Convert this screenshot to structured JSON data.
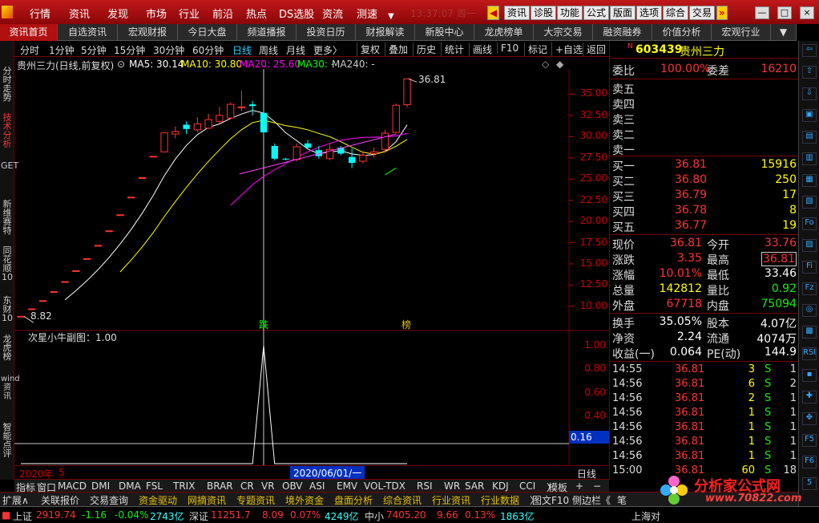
{
  "menu": [
    "行情",
    "资讯",
    "发现",
    "市场",
    "行业",
    "前沿",
    "热点",
    "DS选股",
    "资流",
    "测速"
  ],
  "menu_faint": "13:37:07 周一",
  "top_buttons": [
    "资讯",
    "诊股",
    "功能",
    "公式",
    "版面",
    "选项",
    "综合",
    "交易"
  ],
  "window_buttons": [
    "—",
    "□",
    "×"
  ],
  "tabs": [
    "资讯首页",
    "自选资讯",
    "宏观财报",
    "今日大盘",
    "频道播报",
    "投资日历",
    "财报解读",
    "新股中心",
    "龙虎榜单",
    "大宗交易",
    "融资融券",
    "价值分析",
    "宏观行业"
  ],
  "sidebar": [
    "分时走势",
    "技术分析",
    "GET",
    "新维赛特",
    "同花顺10",
    "东财10",
    "龙虎榜",
    "wind资讯",
    "智能点评"
  ],
  "timeframes": [
    "分时",
    "1分钟",
    "5分钟",
    "15分钟",
    "30分钟",
    "60分钟",
    "日线",
    "周线",
    "月线",
    "更多〉"
  ],
  "toolbar_buttons": [
    "复权",
    "叠加",
    "历史",
    "统计",
    "画线",
    "F10",
    "标记",
    "+自选",
    "返回"
  ],
  "chart_title": "贵州三力(日线,前复权)",
  "ma_labels": {
    "ma5": "MA5: 30.14",
    "ma10": "MA10: 30.80",
    "ma20": "MA20: 25.60",
    "ma30": "MA30: -",
    "ma240": "MA240: -"
  },
  "price_axis": [
    "35.00",
    "32.50",
    "30.00",
    "27.50",
    "25.00",
    "22.50",
    "20.00",
    "17.50",
    "15.00",
    "12.50",
    "10.00"
  ],
  "sub_title": "次星小牛副图：1.00",
  "sub_axis": [
    "1.00",
    "0.80",
    "0.60",
    "0.40",
    "0.16"
  ],
  "markers": {
    "low": "8.82",
    "high": "36.81",
    "die": "跌",
    "bang": "榜"
  },
  "date_bar": {
    "year": "2020年",
    "month": "5",
    "cursor": "2020/06/01/一",
    "period": "日线"
  },
  "indicators": [
    "指标",
    "窗口",
    "MACD",
    "DMI",
    "DMA",
    "FSL",
    "TRIX",
    "BRAR",
    "CR",
    "VR",
    "OBV",
    "ASI",
    "EMV",
    "VOL-TDX",
    "RSI",
    "WR",
    "SAR",
    "KDJ",
    "CCI",
    "〉",
    "模板",
    "+",
    "−"
  ],
  "bottom_tabs": [
    "扩展∧",
    "关联报价",
    "交易查询",
    "资金驱动",
    "网摘资讯",
    "专题资讯",
    "境外资金",
    "盘面分析",
    "综合资讯",
    "行业资讯",
    "行业数据",
    "〉",
    "图文F10",
    "侧边栏《",
    "笔"
  ],
  "status": {
    "sh_label": "上证",
    "sh": "2919.74",
    "sh_chg": "-1.16",
    "sh_pct": "-0.04%",
    "sh_amt": "2743亿",
    "sz_label": "深证",
    "sz": "11251.7",
    "sz_chg": "8.09",
    "sz_pct": "0.07%",
    "sz_amt": "4249亿",
    "zx_label": "中小",
    "zx": "7405.20",
    "zx_chg": "9.66",
    "zx_pct": "0.13%",
    "zx_amt": "1863亿",
    "tail": "上海对"
  },
  "stock": {
    "flag": "N",
    "code": "603439",
    "name": "贵州三力"
  },
  "weibi": {
    "label1": "委比",
    "val1": "100.00%",
    "label2": "委差",
    "val2": "16210"
  },
  "sell": [
    "卖五",
    "卖四",
    "卖三",
    "卖二",
    "卖一"
  ],
  "buy": [
    {
      "label": "买一",
      "price": "36.81",
      "vol": "15916"
    },
    {
      "label": "买二",
      "price": "36.80",
      "vol": "250"
    },
    {
      "label": "买三",
      "price": "36.79",
      "vol": "17"
    },
    {
      "label": "买四",
      "price": "36.78",
      "vol": "8"
    },
    {
      "label": "买五",
      "price": "36.77",
      "vol": "19"
    }
  ],
  "stats": [
    {
      "l1": "现价",
      "v1": "36.81",
      "c1": "red",
      "l2": "今开",
      "v2": "33.76",
      "c2": "red"
    },
    {
      "l1": "涨跌",
      "v1": "3.35",
      "c1": "red",
      "l2": "最高",
      "v2": "36.81",
      "c2": "red"
    },
    {
      "l1": "涨幅",
      "v1": "10.01%",
      "c1": "red",
      "l2": "最低",
      "v2": "33.46",
      "c2": "white"
    },
    {
      "l1": "总量",
      "v1": "142812",
      "c1": "yellow",
      "l2": "量比",
      "v2": "0.92",
      "c2": "green"
    },
    {
      "l1": "外盘",
      "v1": "67718",
      "c1": "red",
      "l2": "内盘",
      "v2": "75094",
      "c2": "green"
    }
  ],
  "fund": [
    {
      "l1": "换手",
      "v1": "35.05%",
      "l2": "股本",
      "v2": "4.07亿"
    },
    {
      "l1": "净资",
      "v1": "2.24",
      "l2": "流通",
      "v2": "4074万"
    },
    {
      "l1": "收益(一)",
      "v1": "0.064",
      "l2": "PE(动)",
      "v2": "144.9"
    }
  ],
  "ticks": [
    {
      "t": "14:55",
      "p": "36.81",
      "v": "3",
      "s": "S",
      "n": "1"
    },
    {
      "t": "14:56",
      "p": "36.81",
      "v": "6",
      "s": "S",
      "n": "2"
    },
    {
      "t": "14:56",
      "p": "36.81",
      "v": "2",
      "s": "S",
      "n": "1"
    },
    {
      "t": "14:56",
      "p": "36.81",
      "v": "1",
      "s": "S",
      "n": "1"
    },
    {
      "t": "14:56",
      "p": "36.81",
      "v": "1",
      "s": "S",
      "n": "1"
    },
    {
      "t": "14:56",
      "p": "36.81",
      "v": "1",
      "s": "S",
      "n": "1"
    },
    {
      "t": "14:56",
      "p": "36.81",
      "v": "1",
      "s": "S",
      "n": "1"
    },
    {
      "t": "15:00",
      "p": "36.81",
      "v": "60",
      "s": "S",
      "n": "18"
    }
  ],
  "right_tools": [
    "⇦",
    "⇧",
    "⇩",
    "▣",
    "▤",
    "▥",
    "▦",
    "▧",
    "Fo",
    "▨",
    "Fi",
    "Fz",
    "◎",
    "▩",
    "RSI",
    "▪",
    "✚",
    "✥",
    "F5",
    "F6",
    "5"
  ],
  "watermark": {
    "text": "分析家公式网",
    "url": "www.70822.com"
  },
  "colors": {
    "up": "#ff3333",
    "down": "#00ffff",
    "ma5": "#ffffff",
    "ma10": "#ffff00",
    "ma20": "#ff00ff",
    "ma30": "#00ff00",
    "bg": "#000000",
    "menu": "#b01010"
  },
  "chart_data": {
    "type": "candlestick",
    "symbol": "603439 贵州三力",
    "ylim": [
      8.0,
      37.5
    ],
    "candles": [
      [
        8.82,
        8.82,
        8.82,
        8.82
      ],
      [
        9.7,
        9.7,
        9.7,
        9.7
      ],
      [
        10.67,
        10.67,
        10.67,
        10.67
      ],
      [
        11.74,
        11.74,
        11.74,
        11.74
      ],
      [
        12.91,
        12.91,
        12.91,
        12.91
      ],
      [
        14.2,
        14.2,
        14.2,
        14.2
      ],
      [
        15.62,
        15.62,
        15.62,
        15.62
      ],
      [
        17.18,
        17.18,
        17.18,
        17.18
      ],
      [
        18.9,
        18.9,
        18.9,
        18.9
      ],
      [
        20.79,
        20.79,
        20.79,
        20.79
      ],
      [
        22.87,
        22.87,
        22.87,
        22.87
      ],
      [
        25.16,
        25.16,
        25.16,
        25.16
      ],
      [
        27.68,
        27.68,
        27.68,
        27.68
      ],
      [
        28.2,
        30.45,
        30.45,
        28.2
      ],
      [
        30.3,
        30.6,
        31.2,
        29.8
      ],
      [
        31.4,
        30.9,
        31.8,
        30.3
      ],
      [
        30.8,
        31.5,
        32.3,
        30.5
      ],
      [
        31.0,
        32.0,
        32.7,
        30.9
      ],
      [
        31.8,
        32.5,
        33.5,
        31.5
      ],
      [
        32.2,
        33.8,
        34.0,
        32.0
      ],
      [
        33.5,
        33.5,
        35.4,
        33.0
      ],
      [
        33.8,
        33.6,
        34.2,
        32.5
      ],
      [
        32.8,
        30.5,
        33.0,
        30.4
      ],
      [
        28.9,
        27.4,
        29.2,
        27.2
      ],
      [
        27.4,
        27.3,
        27.5,
        27.2
      ],
      [
        27.3,
        28.8,
        29.2,
        27.1
      ],
      [
        29.2,
        28.7,
        29.6,
        28.5
      ],
      [
        28.4,
        27.7,
        28.9,
        27.4
      ],
      [
        27.4,
        28.5,
        29.3,
        27.2
      ],
      [
        28.7,
        28.0,
        28.9,
        27.8
      ],
      [
        27.6,
        26.9,
        28.6,
        26.3
      ],
      [
        27.1,
        27.8,
        28.2,
        26.8
      ],
      [
        28.0,
        28.2,
        28.7,
        27.5
      ],
      [
        28.5,
        30.4,
        30.8,
        28.1
      ],
      [
        30.5,
        33.7,
        33.9,
        30.4
      ],
      [
        33.76,
        36.81,
        36.81,
        33.46
      ]
    ],
    "sub_series_x": [
      0,
      21,
      22,
      23,
      24,
      35
    ],
    "sub_series_y": [
      0,
      0,
      1.0,
      0,
      0,
      0
    ]
  }
}
